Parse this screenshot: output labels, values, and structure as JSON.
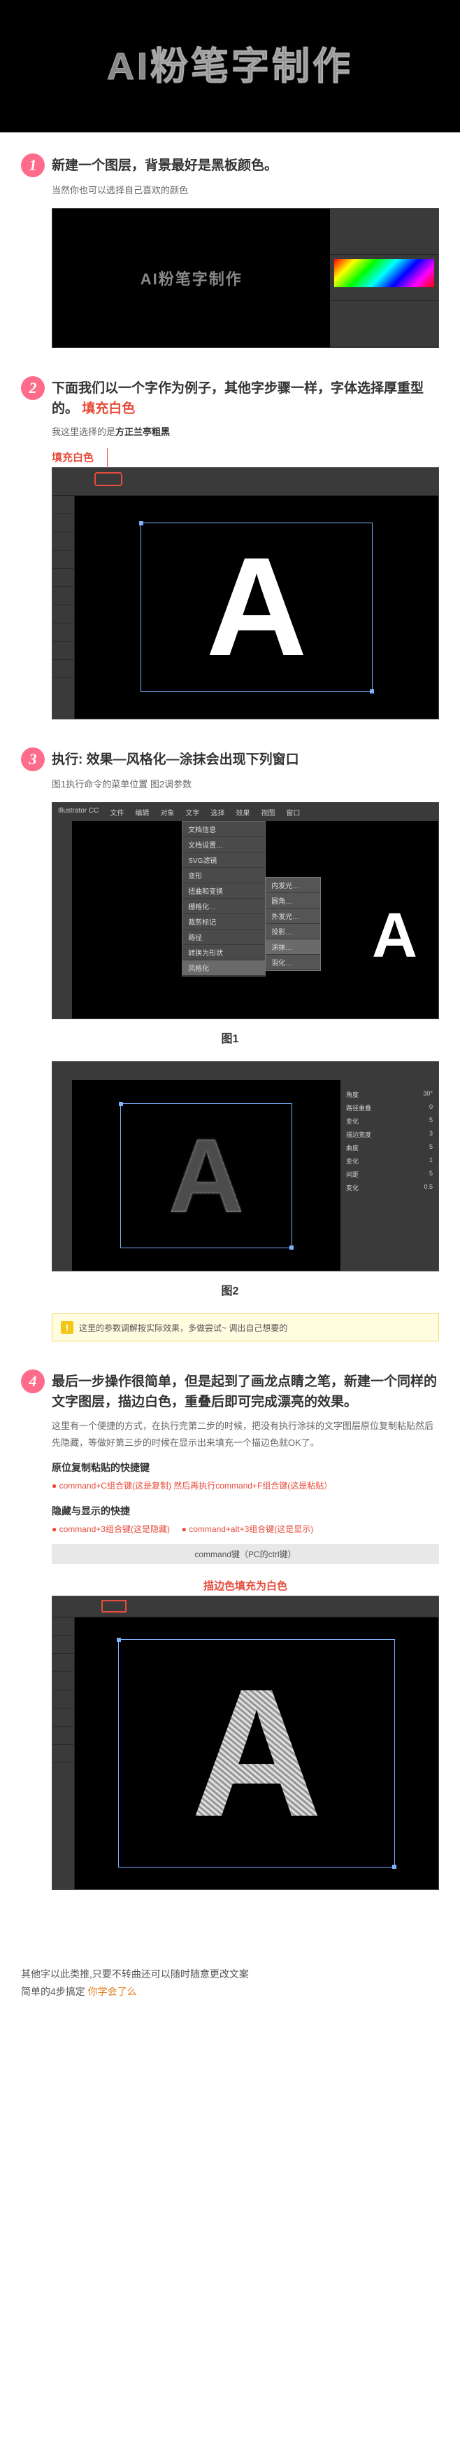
{
  "hero": {
    "title": "AI粉笔字制作"
  },
  "step1": {
    "num": "1",
    "title": "新建一个图层，背景最好是黑板颜色。",
    "note": "当然你也可以选择自己喜欢的颜色",
    "preview_text": "AI粉笔字制作"
  },
  "step2": {
    "num": "2",
    "title_a": "下面我们以一个字作为例子，其他字步骤一样，字体选择厚重型的。",
    "title_b": "填充白色",
    "note_a": "我这里选择的是",
    "note_b": "方正兰亭粗黑",
    "pin_label": "填充白色",
    "letter": "A"
  },
  "step3": {
    "num": "3",
    "title": "执行: 效果—风格化—涂抹会出现下列窗口",
    "note": "图1执行命令的菜单位置    图2调参数",
    "menu": [
      "文档信息",
      "文档设置…",
      "SVG滤镜",
      "变形",
      "扭曲和变换",
      "栅格化…",
      "裁剪标记",
      "路径",
      "转换为形状",
      "风格化"
    ],
    "submenu": [
      "内发光…",
      "圆角…",
      "外发光…",
      "投影…",
      "涂抹…",
      "羽化…"
    ],
    "small_A": "A",
    "fig1": "图1",
    "chalk_A": "A",
    "fig2": "图2",
    "params": [
      {
        "label": "角度",
        "val": "30°"
      },
      {
        "label": "路径重叠",
        "val": "0"
      },
      {
        "label": "变化",
        "val": "5"
      },
      {
        "label": "描边宽度",
        "val": "3"
      },
      {
        "label": "曲度",
        "val": "5"
      },
      {
        "label": "变化",
        "val": "1"
      },
      {
        "label": "间距",
        "val": "5"
      },
      {
        "label": "变化",
        "val": "0.5"
      }
    ],
    "warn": "这里的参数调解按实际效果，多做尝试~ 调出自己想要的"
  },
  "step4": {
    "num": "4",
    "title": "最后一步操作很简单，但是起到了画龙点睛之笔，新建一个同样的文字图层，描边白色，重叠后即可完成漂亮的效果。",
    "p1": "这里有一个便捷的方式，在执行完第二步的时候，把没有执行涂抹的文字图层原位复制粘贴然后先隐藏，等做好第三步的时候在显示出来填充一个描边色就OK了。",
    "kb1_title": "原位复制粘贴的快捷键",
    "kb1_line": "command+C组合键(这是复制) 然后再执行command+F组合键(这是粘贴）",
    "kb2_title": "隐藏与显示的快捷",
    "kb2_a": "command+3组合键(这是隐藏)",
    "kb2_b": "command+alt+3组合键(这是显示)",
    "cmd_bar": "command键（PC的ctrl键）",
    "pin_label": "描边色填充为白色",
    "letter": "A"
  },
  "outro": {
    "line1": "其他字以此类推,只要不转曲还可以随时随意更改文案",
    "line2_a": "简单的4步搞定 ",
    "line2_b": "你学会了么"
  }
}
